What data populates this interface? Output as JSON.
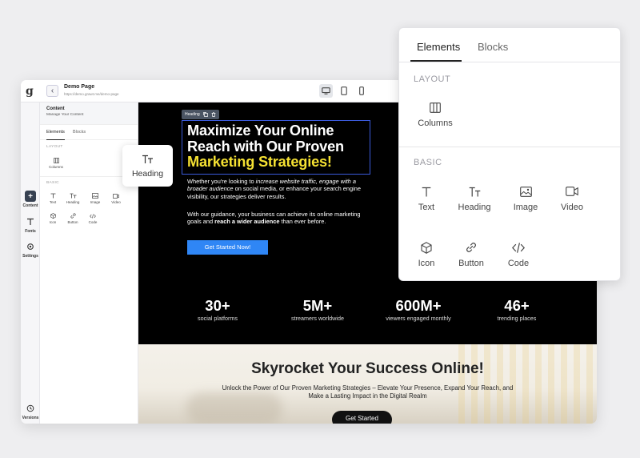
{
  "app": {
    "logo": "g",
    "page_name": "Demo Page",
    "page_url": "https://demo.grawt.me/demo-page",
    "devices": [
      {
        "name": "desktop",
        "active": true
      },
      {
        "name": "tablet",
        "active": false
      },
      {
        "name": "mobile",
        "active": false
      }
    ]
  },
  "rail": {
    "items": [
      {
        "label": "Content",
        "icon": "plus-icon",
        "active": true
      },
      {
        "label": "Fonts",
        "icon": "text-icon",
        "active": false
      },
      {
        "label": "Settings",
        "icon": "gear-icon",
        "active": false
      },
      {
        "label": "Versions",
        "icon": "history-icon",
        "active": false
      }
    ]
  },
  "panel": {
    "title": "Content",
    "subtitle": "Manage Your Content",
    "tabs": [
      "Elements",
      "Blocks"
    ],
    "layout_label": "LAYOUT",
    "basic_label": "BASIC",
    "layout_items": [
      "Columns"
    ],
    "basic_items": [
      "Text",
      "Heading",
      "Image",
      "Video",
      "Icon",
      "Button",
      "Code"
    ]
  },
  "canvas": {
    "heading_chip": "Heading",
    "headline_line1": "Maximize Your Online",
    "headline_line2": "Reach with Our Proven",
    "headline_highlight": "Marketing Strategies!",
    "para1_a": "Whether you're looking to ",
    "para1_em": "increase website traffic, engage with a broader audience",
    "para1_b": " on social media, or enhance your search engine visibility, our strategies deliver results.",
    "para2_a": "With our guidance, your business can achieve its online marketing goals and ",
    "para2_strong": "reach a wider audience",
    "para2_b": " than ever before.",
    "cta": "Get Started Now!",
    "stats": [
      {
        "value": "30+",
        "label": "social platforms"
      },
      {
        "value": "5M+",
        "label": "streamers worldwide"
      },
      {
        "value": "600M+",
        "label": "viewers engaged monthly"
      },
      {
        "value": "46+",
        "label": "trending places"
      }
    ],
    "lower_title": "Skyrocket Your Success Online!",
    "lower_text": "Unlock the Power of Our Proven Marketing Strategies – Elevate Your Presence, Expand Your Reach, and Make a Lasting Impact in the Digital Realm",
    "lower_cta": "Get Started"
  },
  "drag_preview": {
    "label": "Heading",
    "icon": "heading-icon"
  },
  "zoom_panel": {
    "tabs": [
      "Elements",
      "Blocks"
    ],
    "layout_label": "LAYOUT",
    "basic_label": "BASIC",
    "layout_items": [
      {
        "label": "Columns",
        "icon": "columns-icon"
      }
    ],
    "basic_items": [
      {
        "label": "Text",
        "icon": "text-icon"
      },
      {
        "label": "Heading",
        "icon": "heading-icon"
      },
      {
        "label": "Image",
        "icon": "image-icon"
      },
      {
        "label": "Video",
        "icon": "video-icon"
      },
      {
        "label": "Icon",
        "icon": "cube-icon"
      },
      {
        "label": "Button",
        "icon": "link-icon"
      },
      {
        "label": "Code",
        "icon": "code-icon"
      }
    ]
  },
  "colors": {
    "accent_blue": "#2f86f5",
    "highlight_yellow": "#f5e132",
    "hero_bg": "#000000",
    "selection_blue": "#3b5bdb"
  }
}
